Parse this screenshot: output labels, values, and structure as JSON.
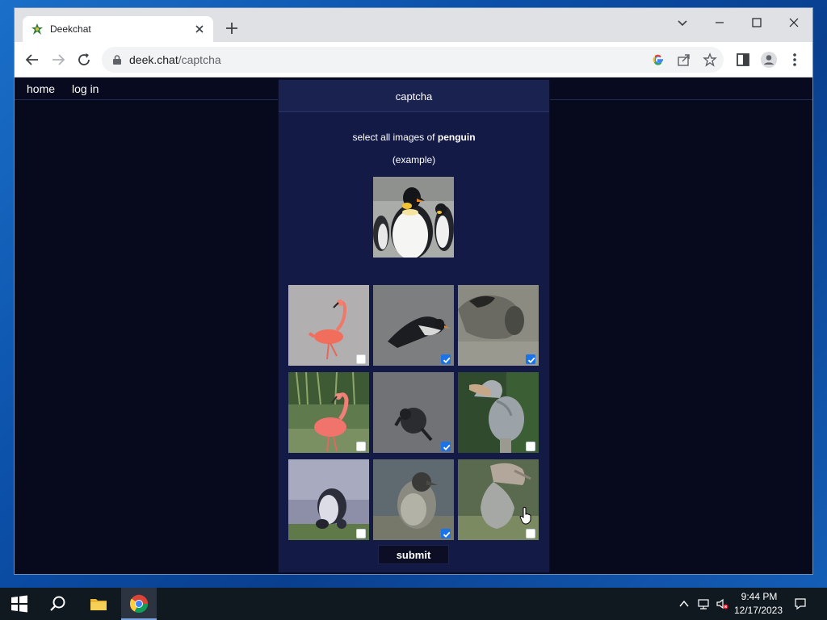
{
  "browser": {
    "tab_title": "Deekchat",
    "url_host": "deek.chat",
    "url_path": "/captcha"
  },
  "nav": {
    "home": "home",
    "login": "log in"
  },
  "captcha": {
    "title": "captcha",
    "instruction_prefix": "select all images of ",
    "target": "penguin",
    "example_label": "(example)",
    "submit_label": "submit",
    "tiles": [
      {
        "subject": "flamingo",
        "checked": false
      },
      {
        "subject": "penguin",
        "checked": true
      },
      {
        "subject": "penguin",
        "checked": true
      },
      {
        "subject": "flamingo",
        "checked": false
      },
      {
        "subject": "penguin",
        "checked": true
      },
      {
        "subject": "shoebill",
        "checked": false
      },
      {
        "subject": "penguin",
        "checked": false
      },
      {
        "subject": "penguin",
        "checked": true
      },
      {
        "subject": "shoebill",
        "checked": false
      }
    ]
  },
  "taskbar": {
    "time": "9:44 PM",
    "date": "12/17/2023"
  },
  "colors": {
    "accent": "#1a73e8",
    "page_bg": "#070a1c",
    "panel_bg": "#141a46"
  }
}
